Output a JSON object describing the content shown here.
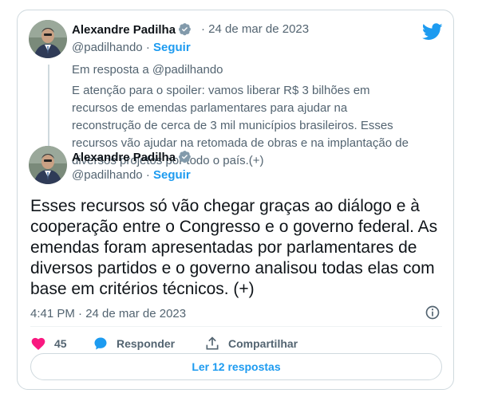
{
  "tweet1": {
    "author_name": "Alexandre Padilha",
    "handle": "@padilhando",
    "follow_label": "Seguir",
    "date": "24 de mar de 2023",
    "reply_to": "Em resposta a @padilhando",
    "text": "E atenção para o spoiler: vamos liberar R$ 3 bilhões em recursos de emendas parlamentares para ajudar na reconstrução de cerca de 3 mil municípios brasileiros. Esses recursos vão ajudar na retomada de obras e na implantação de diversos projetos por todo o país.(+)"
  },
  "tweet2": {
    "author_name": "Alexandre Padilha",
    "handle": "@padilhando",
    "follow_label": "Seguir",
    "text": "Esses recursos só vão chegar graças ao diálogo e à cooperação entre o Congresso e o governo federal. As emendas foram apresentadas por parlamentares de diversos partidos e o governo analisou todas elas com base em critérios técnicos. (+)",
    "timestamp": "4:41 PM · 24 de mar de 2023"
  },
  "actions": {
    "likes": "45",
    "reply_label": "Responder",
    "share_label": "Compartilhar"
  },
  "read_replies_label": "Ler 12 respostas",
  "colors": {
    "accent": "#1d9bf0",
    "like": "#f91880",
    "muted": "#536471",
    "border": "#cfd9de"
  },
  "separator": "·"
}
